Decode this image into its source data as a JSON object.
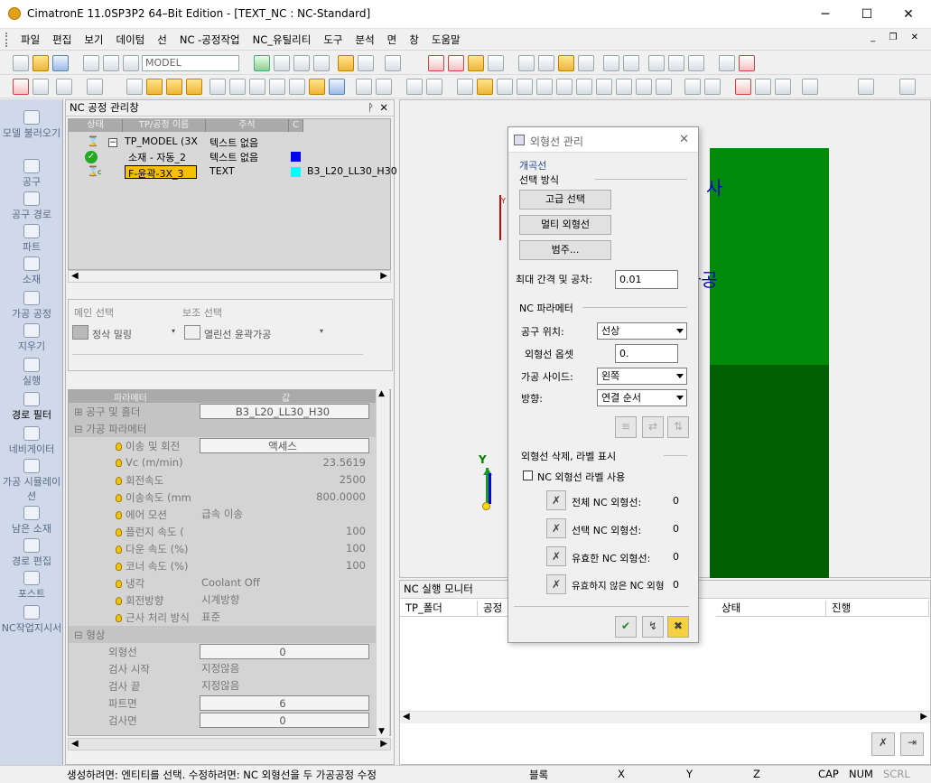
{
  "window": {
    "title": "CimatronE 11.0SP3P2 64–Bit Edition - [TEXT_NC : NC-Standard]",
    "minimize": "─",
    "maximize": "☐",
    "close": "✕"
  },
  "menu": [
    "파일",
    "편집",
    "보기",
    "데이텀",
    "선",
    "NC -공정작업",
    "NC_유틸리티",
    "도구",
    "분석",
    "면",
    "창",
    "도움말"
  ],
  "toolbar": {
    "model_combo": "MODEL"
  },
  "leftbar": [
    {
      "label": "모델 불러오기"
    },
    {
      "label": "공구"
    },
    {
      "label": "공구 경로"
    },
    {
      "label": "파트"
    },
    {
      "label": "소재"
    },
    {
      "label": "가공 공정"
    },
    {
      "label": "지우기"
    },
    {
      "label": "실행"
    },
    {
      "label": "경로 필터"
    },
    {
      "label": "네비게이터"
    },
    {
      "label": "가공 시뮬레이션"
    },
    {
      "label": "남은 소재"
    },
    {
      "label": "경로 편집"
    },
    {
      "label": "포스트"
    },
    {
      "label": "NC작업지시서"
    }
  ],
  "nc_panel": {
    "title": "NC 공정 관리창",
    "pin": "ᚹ",
    "close": "✕",
    "tree_headers": [
      "상태",
      "TP/공정 이름",
      "주석",
      "C"
    ],
    "tree_rows": [
      {
        "name": "TP_MODEL (3X",
        "comment": "텍스트 없음",
        "extra": ""
      },
      {
        "name": "소재 - 자동_2",
        "comment": "텍스트 없음",
        "extra": ""
      },
      {
        "name": "F-윤곽-3X_3",
        "comment": "TEXT",
        "extra": "B3_L20_LL30_H30"
      }
    ],
    "row_marker": "c",
    "main_select_label": "메인 선택",
    "sub_select_label": "보조 선택",
    "main_select_value": "정삭 밀링",
    "sub_select_value": "열린선 윤곽가공",
    "param_header": "파라메터",
    "value_header": "값",
    "params": [
      {
        "key": "공구 및 홀더",
        "value": "B3_L20_LL30_H30",
        "kind": "group",
        "btn": true
      },
      {
        "key": "가공 파라메터",
        "value": "",
        "kind": "group"
      },
      {
        "key": "이송 및 회전",
        "value": "액세스",
        "kind": "bulb",
        "btn": true
      },
      {
        "key": "Vc (m/min)",
        "value": "23.5619",
        "kind": "bulb"
      },
      {
        "key": "회전속도",
        "value": "2500",
        "kind": "bulb"
      },
      {
        "key": "이송속도 (mm",
        "value": "800.0000",
        "kind": "bulb"
      },
      {
        "key": "에어 모션",
        "value": "급속 이송",
        "kind": "bulb",
        "left": true
      },
      {
        "key": "플런지 속도 (",
        "value": "100",
        "kind": "bulb"
      },
      {
        "key": "다운 속도 (%)",
        "value": "100",
        "kind": "bulb"
      },
      {
        "key": "코너 속도 (%)",
        "value": "100",
        "kind": "bulb"
      },
      {
        "key": "냉각",
        "value": "Coolant Off",
        "kind": "bulb",
        "left": true
      },
      {
        "key": "회전방향",
        "value": "시계방향",
        "kind": "bulb",
        "left": true
      },
      {
        "key": "근사 처리 방식",
        "value": "표준",
        "kind": "bulb",
        "left": true
      },
      {
        "key": "형상",
        "value": "",
        "kind": "group"
      },
      {
        "key": "외형선",
        "value": "0",
        "kind": "plain",
        "btn": true
      },
      {
        "key": "검사 시작",
        "value": "지정않음",
        "kind": "plain",
        "left": true
      },
      {
        "key": "검사 끝",
        "value": "지정않음",
        "kind": "plain",
        "left": true
      },
      {
        "key": "파트면",
        "value": "6",
        "kind": "plain",
        "btn": true
      },
      {
        "key": "검사면",
        "value": "0",
        "kind": "plain",
        "btn": true
      }
    ]
  },
  "viewport": {
    "text_a": "사",
    "text_b": "가공",
    "axis_y": "Y",
    "axis_y2": "Y"
  },
  "monitor": {
    "title": "NC 실행 모니터",
    "columns": [
      "TP_폴더",
      "공정",
      "상태",
      "진행"
    ]
  },
  "dialog": {
    "title": "외형선 관리",
    "close": "✕",
    "open_curve": "개곡선",
    "select_method": "선택 방식",
    "btn_advanced": "고급 선택",
    "btn_multi": "멀티 외형선",
    "btn_category": "범주...",
    "gap_label": "최대 간격 및 공차:",
    "gap_value": "0.01",
    "nc_param": "NC 파라메터",
    "tool_pos_label": "공구 위치:",
    "tool_pos_value": "선상",
    "offset_label": "외형선 옵셋",
    "offset_value": "0.",
    "side_label": "가공 사이드:",
    "side_value": "왼쪽",
    "dir_label": "방향:",
    "dir_value": "연결 순서",
    "delete_section": "외형선 삭제, 라벨 표시",
    "label_checkbox": "NC 외형선 라벨 사용",
    "counts": [
      {
        "label": "전체 NC 외형선:",
        "value": "0"
      },
      {
        "label": "선택 NC 외형선:",
        "value": "0"
      },
      {
        "label": "유효한 NC 외형선:",
        "value": "0"
      },
      {
        "label": "유효하지 않은 NC 외형",
        "value": "0"
      }
    ]
  },
  "statusbar": {
    "message": "생성하려면: 엔티티를 선택. 수정하려면: NC 외형선을 두  가공공정 수정",
    "block": "블록",
    "x": "X",
    "y": "Y",
    "z": "Z",
    "cap": "CAP",
    "num": "NUM",
    "scrl": "SCRL"
  },
  "colors": {
    "box_top": "#008a0a",
    "box_front": "#005f00",
    "highlight_row": "#f5c000",
    "blue_swatch": "#0000ee",
    "cyan_swatch": "#00ffff"
  }
}
